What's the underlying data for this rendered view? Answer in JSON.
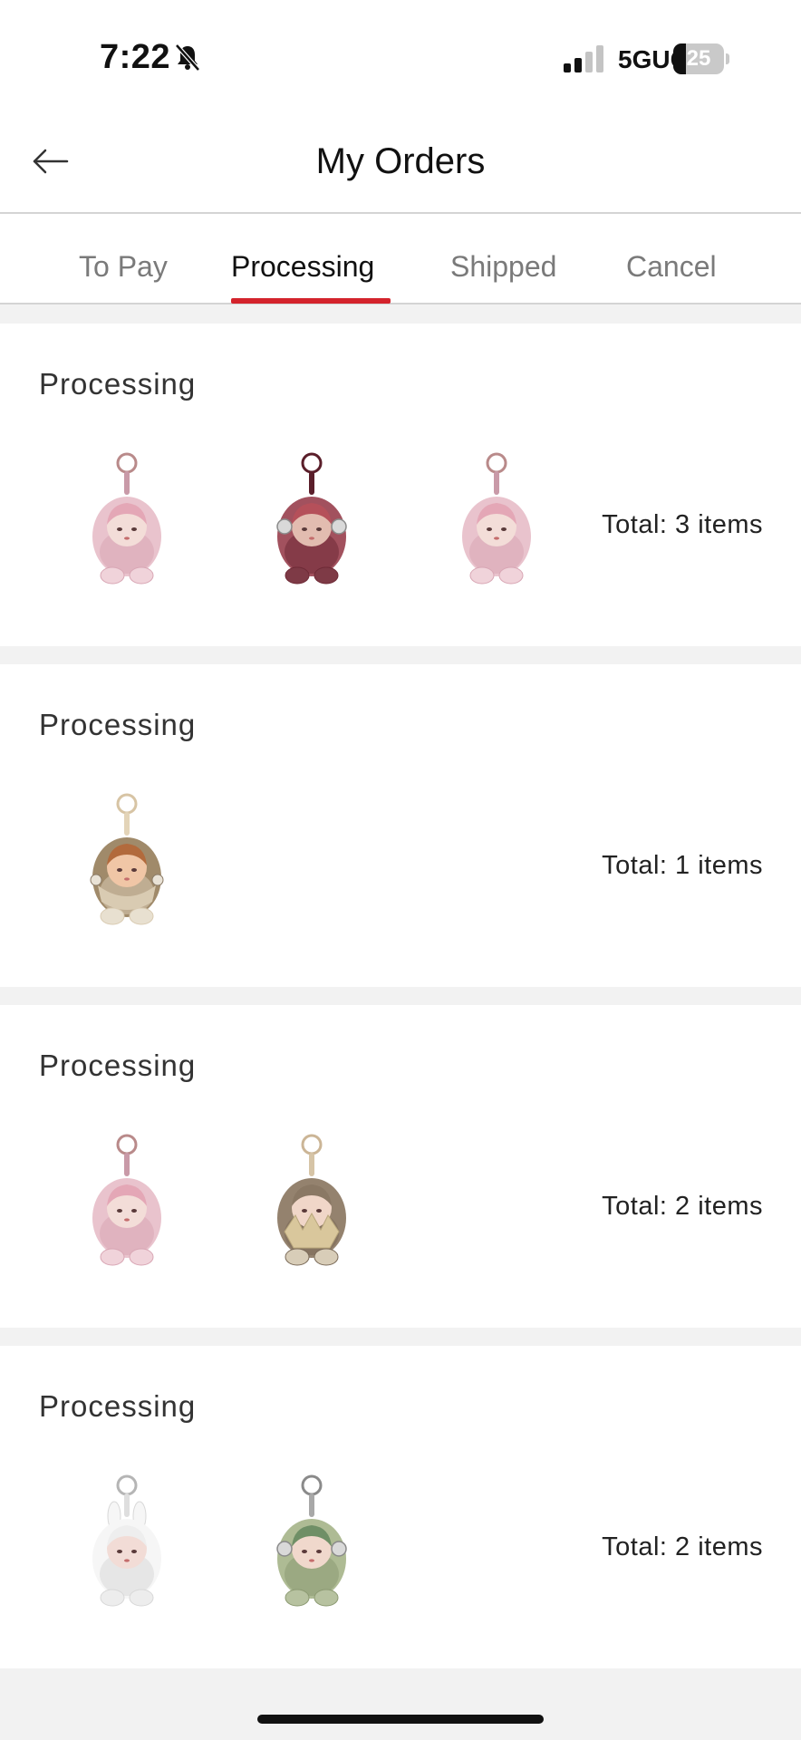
{
  "status_bar": {
    "time": "7:22",
    "network": "5GUC",
    "battery": "25",
    "battery_level": 0.25
  },
  "header": {
    "title": "My Orders",
    "back_icon": "arrow-left-icon"
  },
  "tabs": [
    {
      "label": "To Pay",
      "active": false
    },
    {
      "label": "Processing",
      "active": true
    },
    {
      "label": "Shipped",
      "active": false
    },
    {
      "label": "Cancel",
      "active": false
    }
  ],
  "colors": {
    "accent": "#d4232c",
    "background": "#f2f2f2",
    "card": "#ffffff"
  },
  "orders": [
    {
      "status": "Processing",
      "total": "Total: 3 items",
      "items": [
        {
          "variant": "pink-plush-keychain"
        },
        {
          "variant": "maroon-plush-keychain"
        },
        {
          "variant": "pink-plush-keychain"
        }
      ]
    },
    {
      "status": "Processing",
      "total": "Total: 1 items",
      "items": [
        {
          "variant": "beige-hooded-plush-keychain"
        }
      ]
    },
    {
      "status": "Processing",
      "total": "Total: 2 items",
      "items": [
        {
          "variant": "pink-plush-keychain"
        },
        {
          "variant": "fur-leaf-plush-keychain"
        }
      ]
    },
    {
      "status": "Processing",
      "total": "Total: 2 items",
      "items": [
        {
          "variant": "white-bunny-plush-keychain"
        },
        {
          "variant": "green-plush-keychain"
        }
      ]
    }
  ]
}
